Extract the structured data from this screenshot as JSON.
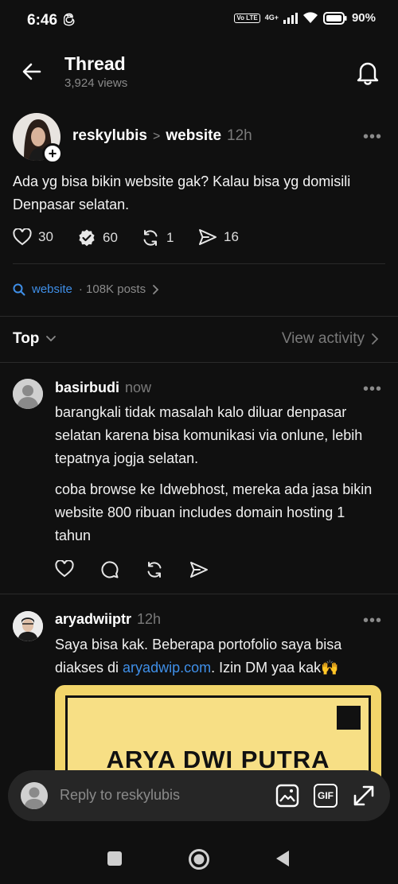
{
  "status_bar": {
    "time": "6:46",
    "volte": "Vo LTE",
    "network": "4G+",
    "battery": "90%"
  },
  "header": {
    "title": "Thread",
    "views": "3,924 views"
  },
  "post": {
    "author": "reskylubis",
    "separator": ">",
    "topic": "website",
    "time": "12h",
    "more": "•••",
    "text": "Ada yg bisa bikin website gak? Kalau bisa yg domisili Denpasar selatan.",
    "likes": "30",
    "reposts_seen": "60",
    "quotes": "1",
    "shares": "16"
  },
  "topic_row": {
    "tag": "website",
    "count": "· 108K posts",
    "chevron": ">"
  },
  "sort": {
    "label": "Top",
    "view_activity": "View activity"
  },
  "replies": [
    {
      "author": "basirbudi",
      "time": "now",
      "paragraphs": [
        "barangkali tidak masalah kalo diluar denpasar selatan karena bisa komunikasi via onlune, lebih tepatnya jogja selatan.",
        "coba browse ke Idwebhost, mereka ada jasa bikin website 800 ribuan includes domain hosting 1 tahun"
      ]
    },
    {
      "author": "aryadwiiptr",
      "time": "12h",
      "text_before": "Saya bisa kak. Beberapa portofolio saya bisa diakses di ",
      "link": "aryadwip.com",
      "text_after": ". Izin DM yaa kak🙌",
      "image_title": "ARYA DWI PUTRA"
    }
  ],
  "composer": {
    "placeholder": "Reply to reskylubis",
    "gif_label": "GIF"
  },
  "colors": {
    "background": "#101010",
    "accent_link": "#3f8fe8",
    "muted": "#8a8a8a",
    "promo_yellow": "#f2d56a"
  }
}
